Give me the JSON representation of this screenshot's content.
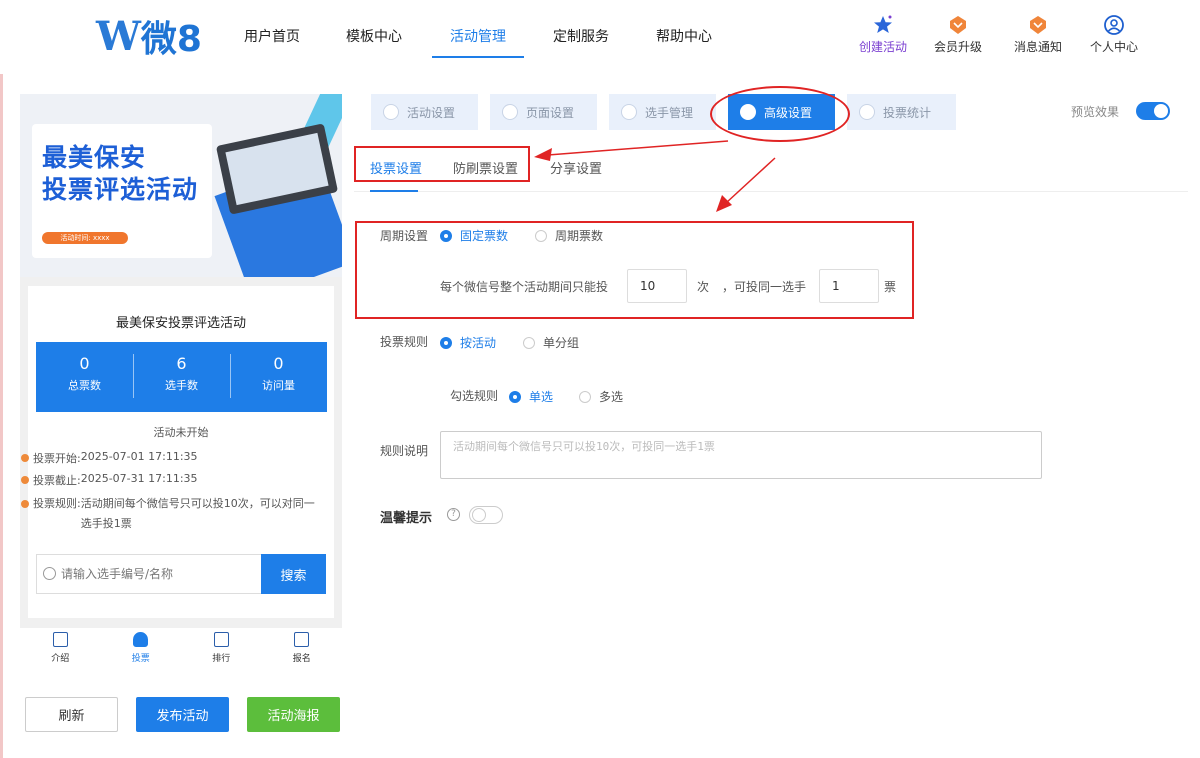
{
  "nav": {
    "brand": "微8",
    "items": [
      "用户首页",
      "模板中心",
      "活动管理",
      "定制服务",
      "帮助中心"
    ],
    "active": "活动管理",
    "tools": [
      "创建活动",
      "会员升级",
      "消息通知",
      "个人中心"
    ]
  },
  "preview": {
    "banner_title_1": "最美保安",
    "banner_title_2": "投票评选活动",
    "banner_time": "活动时间: xxxx",
    "activity_title": "最美保安投票评选活动",
    "stats": [
      {
        "value": "0",
        "label": "总票数"
      },
      {
        "value": "6",
        "label": "选手数"
      },
      {
        "value": "0",
        "label": "访问量"
      }
    ],
    "status": "活动未开始",
    "details": [
      {
        "label": "投票开始:",
        "value": "2025-07-01 17:11:35"
      },
      {
        "label": "投票截止:",
        "value": "2025-07-31 17:11:35"
      },
      {
        "label": "投票规则:",
        "value": "活动期间每个微信号只可以投10次，可以对同一选手投1票"
      }
    ],
    "search_placeholder": "请输入选手编号/名称",
    "search_button": "搜索",
    "tabbar": [
      "介绍",
      "投票",
      "排行",
      "报名"
    ],
    "tabbar_active": "投票"
  },
  "actions": {
    "refresh": "刷新",
    "publish": "发布活动",
    "poster": "活动海报"
  },
  "settings": {
    "tabs": [
      "活动设置",
      "页面设置",
      "选手管理",
      "高级设置",
      "投票统计"
    ],
    "active_tab": "高级设置",
    "preview_label": "预览效果",
    "preview_toggle": true,
    "subtabs": [
      "投票设置",
      "防刷票设置",
      "分享设置"
    ],
    "active_subtab": "投票设置",
    "period_label": "周期设置",
    "period_options": [
      "固定票数",
      "周期票数"
    ],
    "period_selected": "固定票数",
    "limit_prefix": "每个微信号整个活动期间只能投",
    "limit_value": "10",
    "limit_unit": "次",
    "same_prefix": "，可投同一选手",
    "same_value": "1",
    "same_unit": "票",
    "rule_label": "投票规则",
    "rule_options": [
      "按活动",
      "单分组"
    ],
    "rule_selected": "按活动",
    "check_label": "勾选规则",
    "check_options": [
      "单选",
      "多选"
    ],
    "check_selected": "单选",
    "desc_label": "规则说明",
    "desc_placeholder": "活动期间每个微信号只可以投10次，可投同一选手1票",
    "tip_label": "温馨提示",
    "tip_toggle": false
  },
  "colors": {
    "accent": "#1e7ee8",
    "annotation": "#e02424",
    "poster": "#5cbe3c",
    "dot": "#ee8a3a"
  }
}
